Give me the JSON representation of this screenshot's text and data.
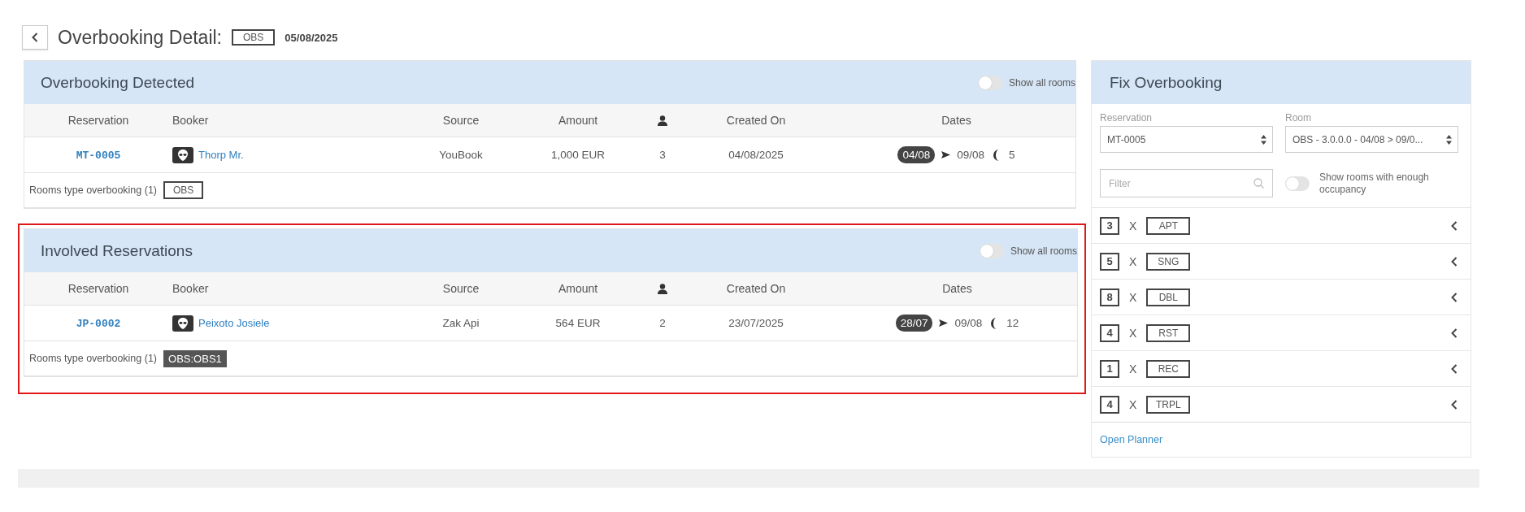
{
  "header": {
    "title": "Overbooking Detail:",
    "tag": "OBS",
    "date": "05/08/2025"
  },
  "panels": [
    {
      "title": "Overbooking Detected",
      "highlighted": false,
      "toggle": {
        "label": "Show all rooms",
        "on": false
      },
      "columns": [
        {
          "kind": "text",
          "label": "Reservation"
        },
        {
          "kind": "text",
          "label": "Booker"
        },
        {
          "kind": "text",
          "label": "Source"
        },
        {
          "kind": "text",
          "label": "Amount"
        },
        {
          "kind": "guests-icon"
        },
        {
          "kind": "text",
          "label": "Created On"
        },
        {
          "kind": "text",
          "label": "Dates"
        }
      ],
      "rows": [
        {
          "reservation": "MT-0005",
          "booker": "Thorp Mr.",
          "source": "YouBook",
          "amount": "1,000 EUR",
          "guests": "3",
          "created_on": "04/08/2025",
          "start": "04/08",
          "end": "09/08",
          "nights": "5"
        }
      ],
      "footer": {
        "label": "Rooms type overbooking (1)",
        "tags": [
          {
            "text": "OBS",
            "kind": "outline"
          }
        ]
      }
    },
    {
      "title": "Involved Reservations",
      "highlighted": true,
      "toggle": {
        "label": "Show all rooms",
        "on": false
      },
      "columns": [
        {
          "kind": "text",
          "label": "Reservation"
        },
        {
          "kind": "text",
          "label": "Booker"
        },
        {
          "kind": "text",
          "label": "Source"
        },
        {
          "kind": "text",
          "label": "Amount"
        },
        {
          "kind": "guests-icon"
        },
        {
          "kind": "text",
          "label": "Created On"
        },
        {
          "kind": "text",
          "label": "Dates"
        }
      ],
      "rows": [
        {
          "reservation": "JP-0002",
          "booker": "Peixoto Josiele",
          "source": "Zak Api",
          "amount": "564 EUR",
          "guests": "2",
          "created_on": "23/07/2025",
          "start": "28/07",
          "end": "09/08",
          "nights": "12"
        }
      ],
      "footer": {
        "label": "Rooms type overbooking (1)",
        "tags": [
          {
            "text": "OBS:OBS1",
            "kind": "filled"
          }
        ]
      }
    }
  ],
  "fix": {
    "title": "Fix Overbooking",
    "reservation": {
      "label": "Reservation",
      "value": "MT-0005"
    },
    "room": {
      "label": "Room",
      "value": "OBS - 3.0.0.0 - 04/08 > 09/0..."
    },
    "filter": {
      "placeholder": "Filter"
    },
    "toggle": {
      "label": "Show rooms with enough occupancy",
      "on": false
    },
    "room_types": [
      {
        "count": "3",
        "separator": "X",
        "code": "APT"
      },
      {
        "count": "5",
        "separator": "X",
        "code": "SNG"
      },
      {
        "count": "8",
        "separator": "X",
        "code": "DBL"
      },
      {
        "count": "4",
        "separator": "X",
        "code": "RST"
      },
      {
        "count": "1",
        "separator": "X",
        "code": "REC"
      },
      {
        "count": "4",
        "separator": "X",
        "code": "TRPL"
      }
    ],
    "link": "Open Planner"
  }
}
